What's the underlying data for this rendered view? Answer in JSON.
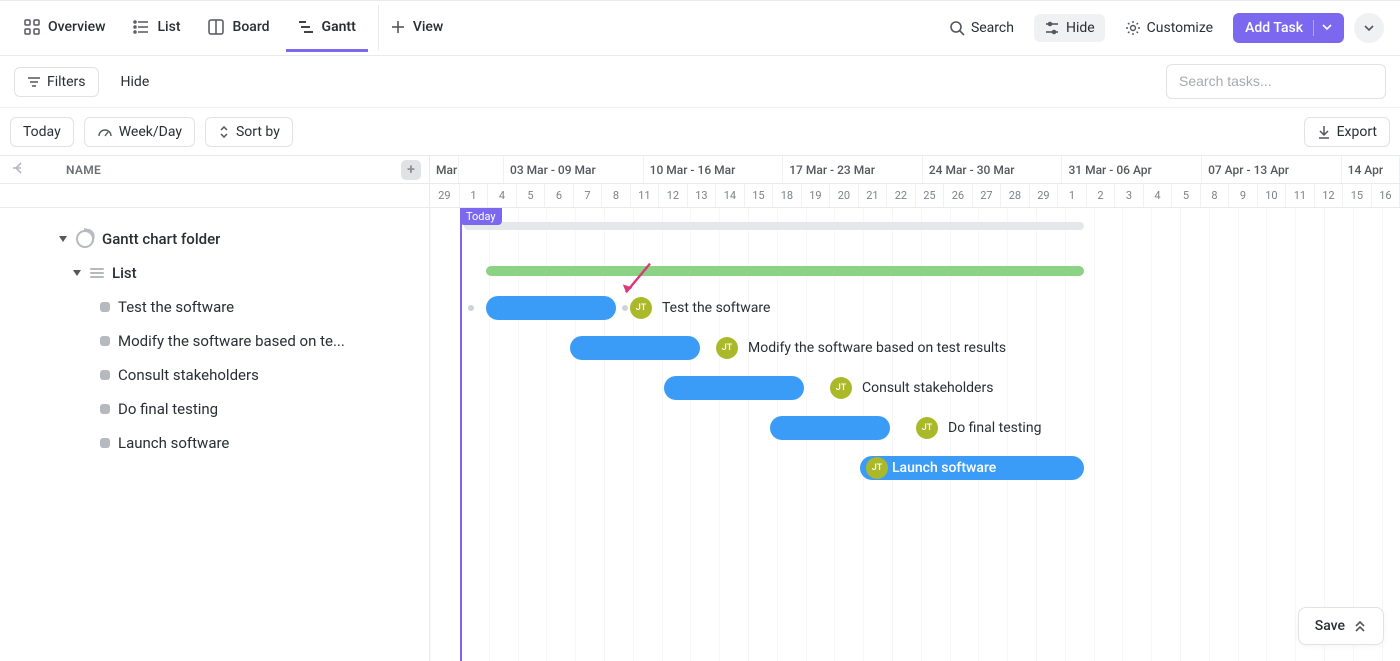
{
  "nav": {
    "overview": "Overview",
    "list": "List",
    "board": "Board",
    "gantt": "Gantt",
    "view": "View",
    "search": "Search",
    "hide": "Hide",
    "customize": "Customize",
    "add_task": "Add Task"
  },
  "filterbar": {
    "filters": "Filters",
    "hide": "Hide",
    "search_placeholder": "Search tasks..."
  },
  "toolbar": {
    "today": "Today",
    "weekday": "Week/Day",
    "sortby": "Sort by",
    "export": "Export"
  },
  "tree": {
    "header": "NAME",
    "folder": "Gantt chart folder",
    "list": "List",
    "tasks": [
      "Test the software",
      "Modify the software based on te...",
      "Consult stakeholders",
      "Do final testing",
      "Launch software"
    ]
  },
  "timeline": {
    "month_start": "Mar",
    "weeks": [
      "03 Mar - 09 Mar",
      "10 Mar - 16 Mar",
      "17 Mar - 23 Mar",
      "24 Mar - 30 Mar",
      "31 Mar - 06 Apr",
      "07 Apr - 13 Apr",
      "14 Apr"
    ],
    "days": [
      "29",
      "1",
      "4",
      "5",
      "6",
      "7",
      "8",
      "11",
      "12",
      "13",
      "14",
      "15",
      "18",
      "19",
      "20",
      "21",
      "22",
      "25",
      "26",
      "27",
      "28",
      "29",
      "1",
      "2",
      "3",
      "4",
      "5",
      "8",
      "9",
      "10",
      "11",
      "12",
      "15",
      "16"
    ],
    "today_label": "Today"
  },
  "gantt_tasks": [
    {
      "label": "Test the software",
      "assignee": "JT"
    },
    {
      "label": "Modify the software based on test results",
      "assignee": "JT"
    },
    {
      "label": "Consult stakeholders",
      "assignee": "JT"
    },
    {
      "label": "Do final testing",
      "assignee": "JT"
    },
    {
      "label": "Launch software",
      "assignee": "JT"
    }
  ],
  "save": "Save",
  "chart_data": {
    "type": "gantt",
    "title": "Gantt chart folder",
    "x_unit": "date",
    "today": "2025-03-01",
    "date_range": [
      "2025-02-29",
      "2025-04-16"
    ],
    "summary_bar": {
      "start": "2025-03-01",
      "end": "2025-04-01"
    },
    "group_bar": {
      "start": "2025-03-03",
      "end": "2025-04-01"
    },
    "tasks": [
      {
        "name": "Test the software",
        "start": "2025-03-03",
        "end": "2025-03-07",
        "assignee": "JT"
      },
      {
        "name": "Modify the software based on test results",
        "start": "2025-03-06",
        "end": "2025-03-12",
        "assignee": "JT"
      },
      {
        "name": "Consult stakeholders",
        "start": "2025-03-11",
        "end": "2025-03-17",
        "assignee": "JT"
      },
      {
        "name": "Do final testing",
        "start": "2025-03-16",
        "end": "2025-03-21",
        "assignee": "JT"
      },
      {
        "name": "Launch software",
        "start": "2025-03-20",
        "end": "2025-04-01",
        "assignee": "JT"
      }
    ]
  }
}
